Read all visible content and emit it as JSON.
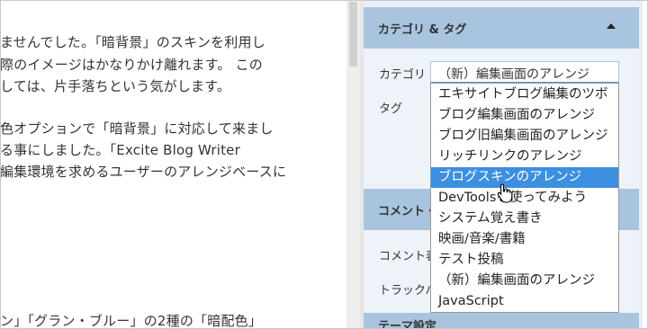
{
  "editor": {
    "lines": [
      "ませんでした。「暗背景」のスキンを利用し",
      "際のイメージはかなりかけ離れます。 この",
      "しては、片手落ちという気がします。",
      "色オプションで「暗背景」に対応して来まし",
      "る事にしました。「Excite Blog Writer",
      "編集環境を求めるユーザーのアレンジベースに",
      "ン」「グラン・ブルー」の2種の「暗配色」"
    ]
  },
  "sidebar": {
    "category_panel": {
      "title": "カテゴリ & タグ",
      "category_label": "カテゴリ",
      "tag_label": "タグ",
      "selected_value": "（新）編集画面のアレンジ"
    },
    "comment_panel": {
      "title": "コメント・",
      "comment_label": "コメント表",
      "trackback_label": "トラックバ"
    },
    "bottom_panel_title": "テーマ設定"
  },
  "dropdown": {
    "options": [
      "エキサイトブログ編集のツボ",
      "ブログ編集画面のアレンジ",
      "ブログ旧編集画面のアレンジ",
      "リッチリンクのアレンジ",
      "ブログスキンのアレンジ",
      "DevToolsを使ってみよう",
      "システム覚え書き",
      "映画/音楽/書籍",
      "テスト投稿",
      "（新）編集画面のアレンジ",
      "JavaScript"
    ],
    "highlighted_index": 4
  },
  "colors": {
    "panel_header": "#a9c4de",
    "highlight": "#3d8fe0",
    "select_focus": "#5b8fd1"
  }
}
